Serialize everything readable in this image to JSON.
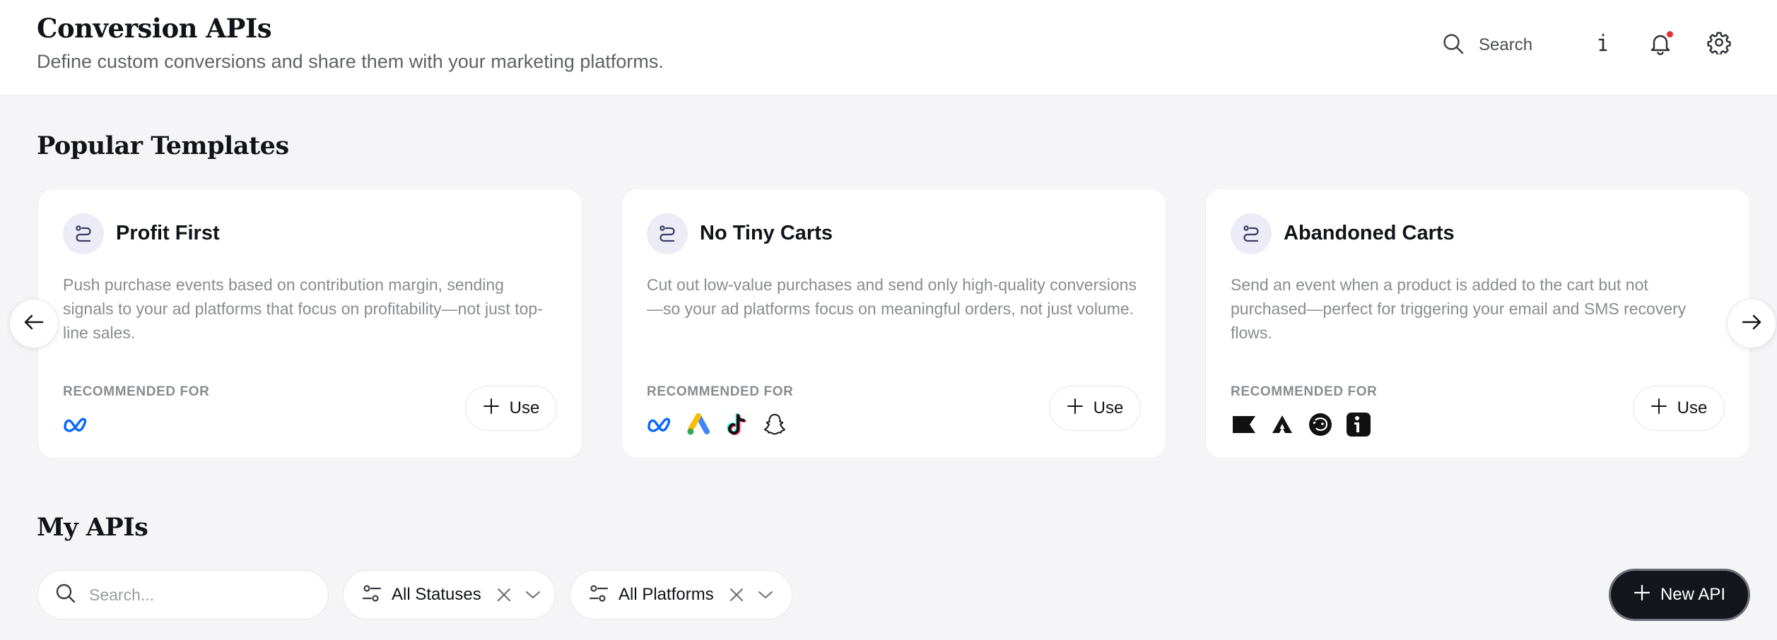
{
  "header": {
    "title": "Conversion APIs",
    "subtitle": "Define custom conversions and share them with your marketing platforms.",
    "search_label": "Search",
    "icons": [
      "search-icon",
      "info-icon",
      "bell-icon",
      "gear-icon"
    ],
    "has_notification": true
  },
  "popular": {
    "title": "Popular Templates",
    "cards": [
      {
        "title": "Profit First",
        "description": "Push purchase events based on contribution margin, sending signals to your ad platforms that focus on profitability—not just top-line sales.",
        "recommended_label": "RECOMMENDED FOR",
        "platforms": [
          "meta"
        ],
        "use_label": "Use"
      },
      {
        "title": "No Tiny Carts",
        "description": "Cut out low-value purchases and send only high-quality conversions—so your ad platforms focus on meaningful orders, not just volume.",
        "recommended_label": "RECOMMENDED FOR",
        "platforms": [
          "meta",
          "google-ads",
          "tiktok",
          "snapchat"
        ],
        "use_label": "Use"
      },
      {
        "title": "Abandoned Carts",
        "description": "Send an event when a product is added to the cart but not purchased—perfect for triggering your email and SMS recovery flows.",
        "recommended_label": "RECOMMENDED FOR",
        "platforms": [
          "klaviyo",
          "attentive",
          "mailchimp",
          "iterable"
        ],
        "use_label": "Use"
      }
    ]
  },
  "my_apis": {
    "title": "My APIs",
    "search_placeholder": "Search...",
    "status_filter": "All Statuses",
    "platform_filter": "All Platforms",
    "new_button": "New API"
  },
  "colors": {
    "background": "#f5f5f7",
    "card": "#ffffff",
    "primary_button": "#15161c",
    "notification": "#e5322d",
    "meta_blue": "#0866ff"
  }
}
